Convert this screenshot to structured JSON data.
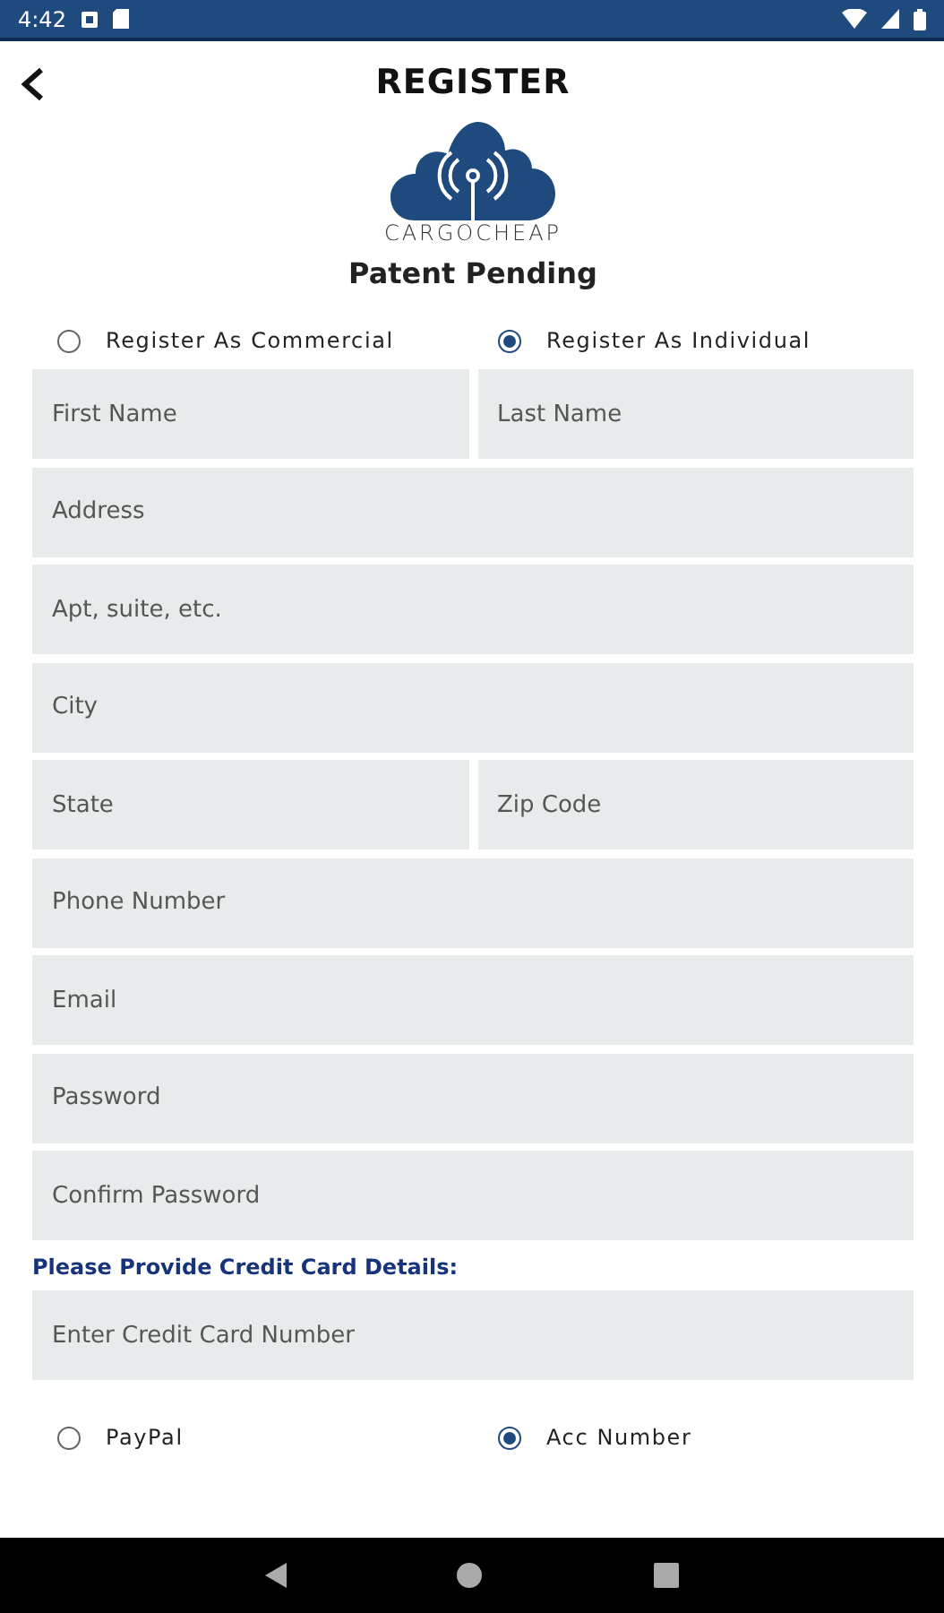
{
  "status_bar": {
    "time": "4:42"
  },
  "header": {
    "title": "REGISTER"
  },
  "logo": {
    "text": "CARGOCHEAP"
  },
  "subtitle": "Patent Pending",
  "account_type": [
    {
      "label": "Register As Commercial",
      "selected": false
    },
    {
      "label": "Register As Individual",
      "selected": true
    }
  ],
  "field_rows": [
    [
      {
        "placeholder": "First Name"
      },
      {
        "placeholder": "Last Name"
      }
    ],
    [
      {
        "placeholder": "Address"
      }
    ],
    [
      {
        "placeholder": "Apt, suite, etc."
      }
    ],
    [
      {
        "placeholder": "City"
      }
    ],
    [
      {
        "placeholder": "State"
      },
      {
        "placeholder": "Zip Code"
      }
    ],
    [
      {
        "placeholder": "Phone Number"
      }
    ],
    [
      {
        "placeholder": "Email"
      }
    ],
    [
      {
        "placeholder": "Password"
      }
    ],
    [
      {
        "placeholder": "Confirm Password"
      }
    ]
  ],
  "credit_card": {
    "heading": "Please Provide Credit Card Details:",
    "placeholder": "Enter Credit Card Number"
  },
  "payment_method": [
    {
      "label": "PayPal",
      "selected": false
    },
    {
      "label": "Acc Number",
      "selected": true
    }
  ]
}
